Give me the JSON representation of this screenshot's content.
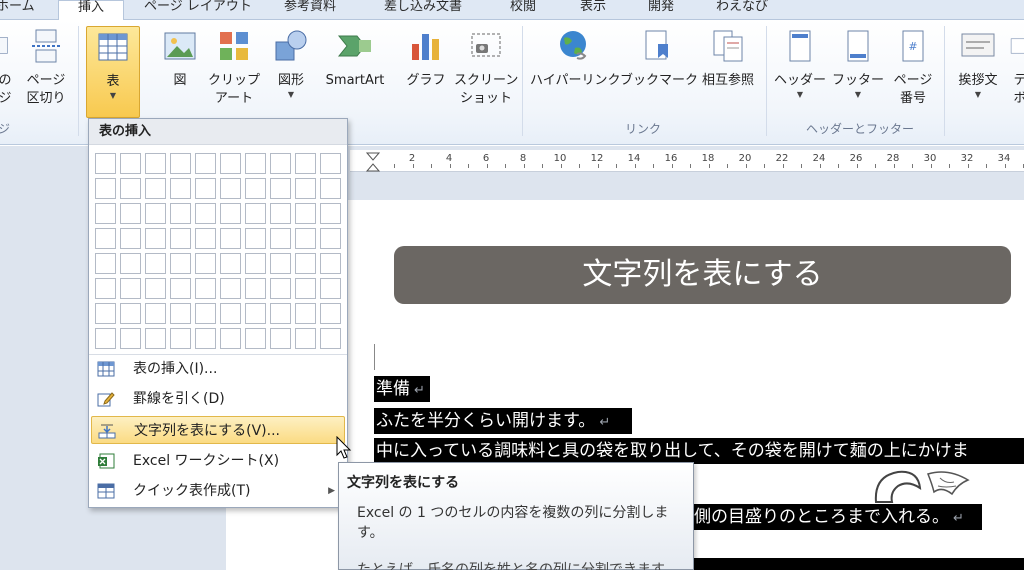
{
  "tabs": [
    {
      "label": "ホーム",
      "active": false
    },
    {
      "label": "挿入",
      "active": true
    },
    {
      "label": "ページ レイアウト",
      "active": false
    },
    {
      "label": "参考資料",
      "active": false
    },
    {
      "label": "差し込み文書",
      "active": false
    },
    {
      "label": "校閲",
      "active": false
    },
    {
      "label": "表示",
      "active": false
    },
    {
      "label": "開発",
      "active": false
    },
    {
      "label": "わえなび",
      "active": false
    }
  ],
  "ribbon": {
    "page_partial": {
      "label1": "の",
      "label2": "ジ"
    },
    "page_break": {
      "label1": "ページ",
      "label2": "区切り"
    },
    "page_group_partial": "ジ",
    "table": {
      "label": "表"
    },
    "picture": {
      "label": "図"
    },
    "clipart": {
      "label1": "クリップ",
      "label2": "アート"
    },
    "shapes": {
      "label": "図形"
    },
    "smartart": {
      "label": "SmartArt"
    },
    "chart": {
      "label": "グラフ"
    },
    "screenshot": {
      "label1": "スクリーン",
      "label2": "ショット"
    },
    "hyperlink": {
      "label": "ハイパーリンク"
    },
    "bookmark": {
      "label": "ブックマーク"
    },
    "crossref": {
      "label": "相互参照"
    },
    "header": {
      "label": "ヘッダー"
    },
    "footer": {
      "label": "フッター"
    },
    "pagenum": {
      "label1": "ページ",
      "label2": "番号"
    },
    "greeting": {
      "label": "挨拶文"
    },
    "text_partial": {
      "label1": "テ",
      "label2": "ボ"
    },
    "groups": {
      "links": "リンク",
      "header_footer": "ヘッダーとフッター"
    }
  },
  "ruler": {
    "numbers": [
      "2",
      "4",
      "6",
      "8",
      "10",
      "12",
      "14",
      "16",
      "18",
      "20",
      "22",
      "24",
      "26",
      "28",
      "30",
      "32",
      "34"
    ]
  },
  "dropdown": {
    "title": "表の挿入",
    "items": [
      {
        "label": "表の挿入(I)..."
      },
      {
        "label": "罫線を引く(D)"
      },
      {
        "label": "文字列を表にする(V)..."
      },
      {
        "label": "Excel ワークシート(X)"
      },
      {
        "label": "クイック表作成(T)"
      }
    ]
  },
  "banner": {
    "text": "文字列を表にする"
  },
  "document": {
    "lines": [
      "準備",
      "ふたを半分くらい開けます。",
      "中に入っている調味料と具の袋を取り出して、その袋を開けて麺の上にかけま",
      "側の目盛りのところまで入れる。"
    ],
    "pilcrow": "↵"
  },
  "tooltip": {
    "title": "文字列を表にする",
    "body": "Excel の 1 つのセルの内容を複数の列に分割します。",
    "more": "たとえば、氏名の列を姓と名の列に分割できます"
  }
}
